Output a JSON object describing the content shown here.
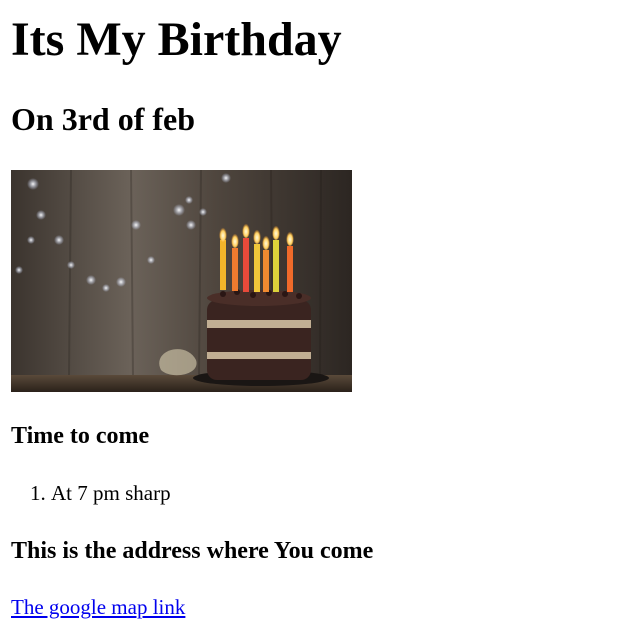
{
  "page": {
    "title": "Its My Birthday",
    "date_heading": "On 3rd of feb",
    "image": {
      "icon": "birthday-cake-photo"
    },
    "time_heading": "Time to come",
    "time_list": [
      "At 7 pm sharp"
    ],
    "address_heading": "This is the address where You come",
    "map_link_text": "The google map link"
  }
}
